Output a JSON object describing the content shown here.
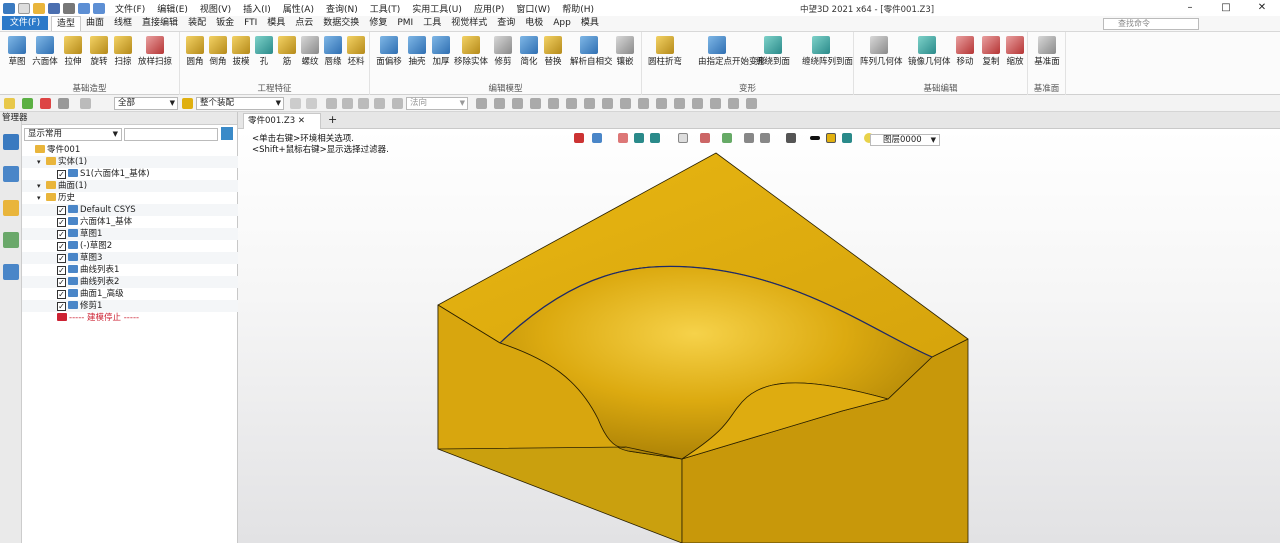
{
  "app": {
    "window_title": "中望3D 2021 x64 - [零件001.Z3]"
  },
  "menubar": [
    "文件(F)",
    "编辑(E)",
    "视图(V)",
    "插入(I)",
    "属性(A)",
    "查询(N)",
    "工具(T)",
    "实用工具(U)",
    "应用(P)",
    "窗口(W)",
    "帮助(H)"
  ],
  "ribbon_tabs": [
    "文件(F)",
    "造型",
    "曲面",
    "线框",
    "直接编辑",
    "装配",
    "钣金",
    "FTI",
    "模具",
    "点云",
    "数据交换",
    "修复",
    "PMI",
    "工具",
    "视觉样式",
    "查询",
    "电极",
    "App",
    "模具"
  ],
  "search_placeholder": "查找命令",
  "ribbon_groups": [
    {
      "label": "基础造型",
      "buttons": [
        "草图",
        "六面体",
        "拉伸",
        "旋转",
        "扫掠",
        "放样扫掠"
      ]
    },
    {
      "label": "工程特征",
      "buttons": [
        "圆角",
        "倒角",
        "拔模",
        "孔",
        "筋",
        "螺纹",
        "唇缘",
        "坯料"
      ]
    },
    {
      "label": "编辑模型",
      "buttons": [
        "面偏移",
        "抽壳",
        "加厚",
        "移除实体",
        "修剪",
        "简化",
        "替换",
        "解析自相交",
        "镶嵌"
      ]
    },
    {
      "label": "变形",
      "buttons": [
        "圆柱折弯",
        "由指定点开始变形",
        "缠绕到面",
        "缠绕阵列到面"
      ]
    },
    {
      "label": "基础编辑",
      "buttons": [
        "阵列几何体",
        "镜像几何体",
        "移动",
        "复制",
        "缩放"
      ]
    },
    {
      "label": "基准面",
      "buttons": [
        "基准面"
      ]
    }
  ],
  "toolbar2": {
    "filter_all": "全部",
    "assembly": "整个装配",
    "normal": "法向"
  },
  "manager": {
    "title": "管理器",
    "filter": "显示常用"
  },
  "tree": [
    {
      "label": "零件001",
      "indent": 0,
      "check": false
    },
    {
      "label": "实体(1)",
      "indent": 1,
      "check": false
    },
    {
      "label": "S1(六面体1_基体)",
      "indent": 2,
      "check": true
    },
    {
      "label": "曲面(1)",
      "indent": 1,
      "check": false
    },
    {
      "label": "历史",
      "indent": 1,
      "check": false
    },
    {
      "label": "Default CSYS",
      "indent": 2,
      "check": true
    },
    {
      "label": "六面体1_基体",
      "indent": 2,
      "check": true
    },
    {
      "label": "草图1",
      "indent": 2,
      "check": true
    },
    {
      "label": "(-)草图2",
      "indent": 2,
      "check": true
    },
    {
      "label": "草图3",
      "indent": 2,
      "check": true
    },
    {
      "label": "曲线列表1",
      "indent": 2,
      "check": true
    },
    {
      "label": "曲线列表2",
      "indent": 2,
      "check": true
    },
    {
      "label": "曲面1_高级",
      "indent": 2,
      "check": true
    },
    {
      "label": "修剪1",
      "indent": 2,
      "check": true
    },
    {
      "label": "----- 建模停止 -----",
      "indent": 2,
      "check": false,
      "stop": true
    }
  ],
  "doc_tab": "零件001.Z3",
  "hints": [
    "<单击右键>环境相关选项.",
    "<Shift+鼠标右键>显示选择过滤器."
  ],
  "layer": "图层0000",
  "colors": {
    "model": "#e2b10f",
    "model_shade": "#c4950a",
    "accent": "#2b79c9"
  }
}
